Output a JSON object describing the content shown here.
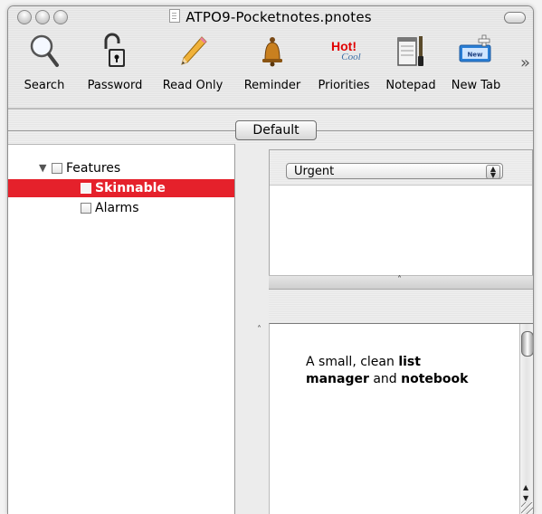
{
  "window": {
    "title": "ATPO9-Pocketnotes.pnotes"
  },
  "toolbar": {
    "items": [
      {
        "label": "Search",
        "icon": "magnifier-icon"
      },
      {
        "label": "Password",
        "icon": "padlock-icon"
      },
      {
        "label": "Read Only",
        "icon": "pencil-icon"
      },
      {
        "label": "Reminder",
        "icon": "bell-icon"
      },
      {
        "label": "Priorities",
        "icon": "hot-cool-icon",
        "hot": "Hot!",
        "cool": "Cool"
      },
      {
        "label": "Notepad",
        "icon": "notepad-icon"
      },
      {
        "label": "New Tab",
        "icon": "new-tab-icon",
        "badge": "New"
      }
    ],
    "overflow": "»"
  },
  "tabs": {
    "active": "Default"
  },
  "outline": {
    "items": [
      {
        "label": "Features",
        "expanded": true
      },
      {
        "label": "Skinnable",
        "selected": true
      },
      {
        "label": "Alarms"
      }
    ]
  },
  "priority_popup": {
    "value": "Urgent"
  },
  "notes": {
    "t1": "A small, clean ",
    "b1": "list",
    "b2": "manager",
    "t2": " and ",
    "b3": "notebook"
  },
  "colors": {
    "selection": "#e5212b",
    "hot": "#e00000",
    "cool": "#3a6ea5"
  }
}
